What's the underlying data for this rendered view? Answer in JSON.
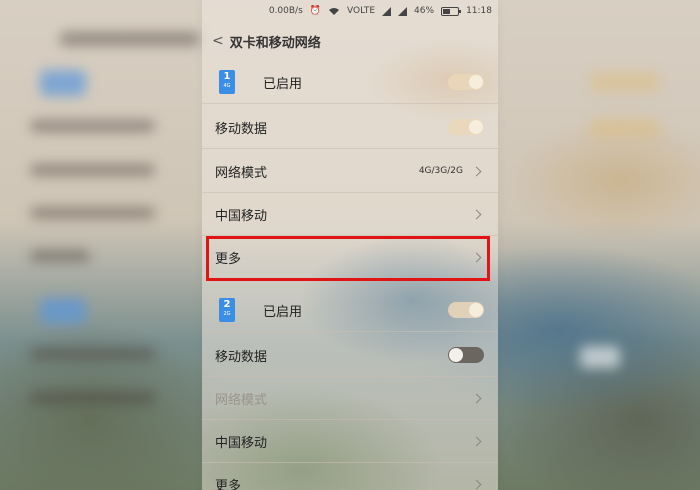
{
  "status": {
    "speed": "0.00B/s",
    "network": "VOLTE",
    "battery": "46%",
    "time": "11:18"
  },
  "header": {
    "back_icon": "chevron-left-icon",
    "title": "双卡和移动网络"
  },
  "sim1": {
    "number": "1",
    "type": "4G",
    "label": "已启用",
    "color": "#3a8ee6",
    "enabled": true,
    "mobile_data_label": "移动数据",
    "mobile_data_on": true,
    "network_mode_label": "网络模式",
    "network_mode_value": "4G/3G/2G",
    "carrier_label": "中国移动",
    "more_label": "更多"
  },
  "sim2": {
    "number": "2",
    "type": "2G",
    "label": "已启用",
    "color": "#3a8ee6",
    "enabled": true,
    "mobile_data_label": "移动数据",
    "mobile_data_on": false,
    "network_mode_label": "网络模式",
    "carrier_label": "中国移动",
    "more_label": "更多"
  },
  "highlight_color": "#e01414"
}
